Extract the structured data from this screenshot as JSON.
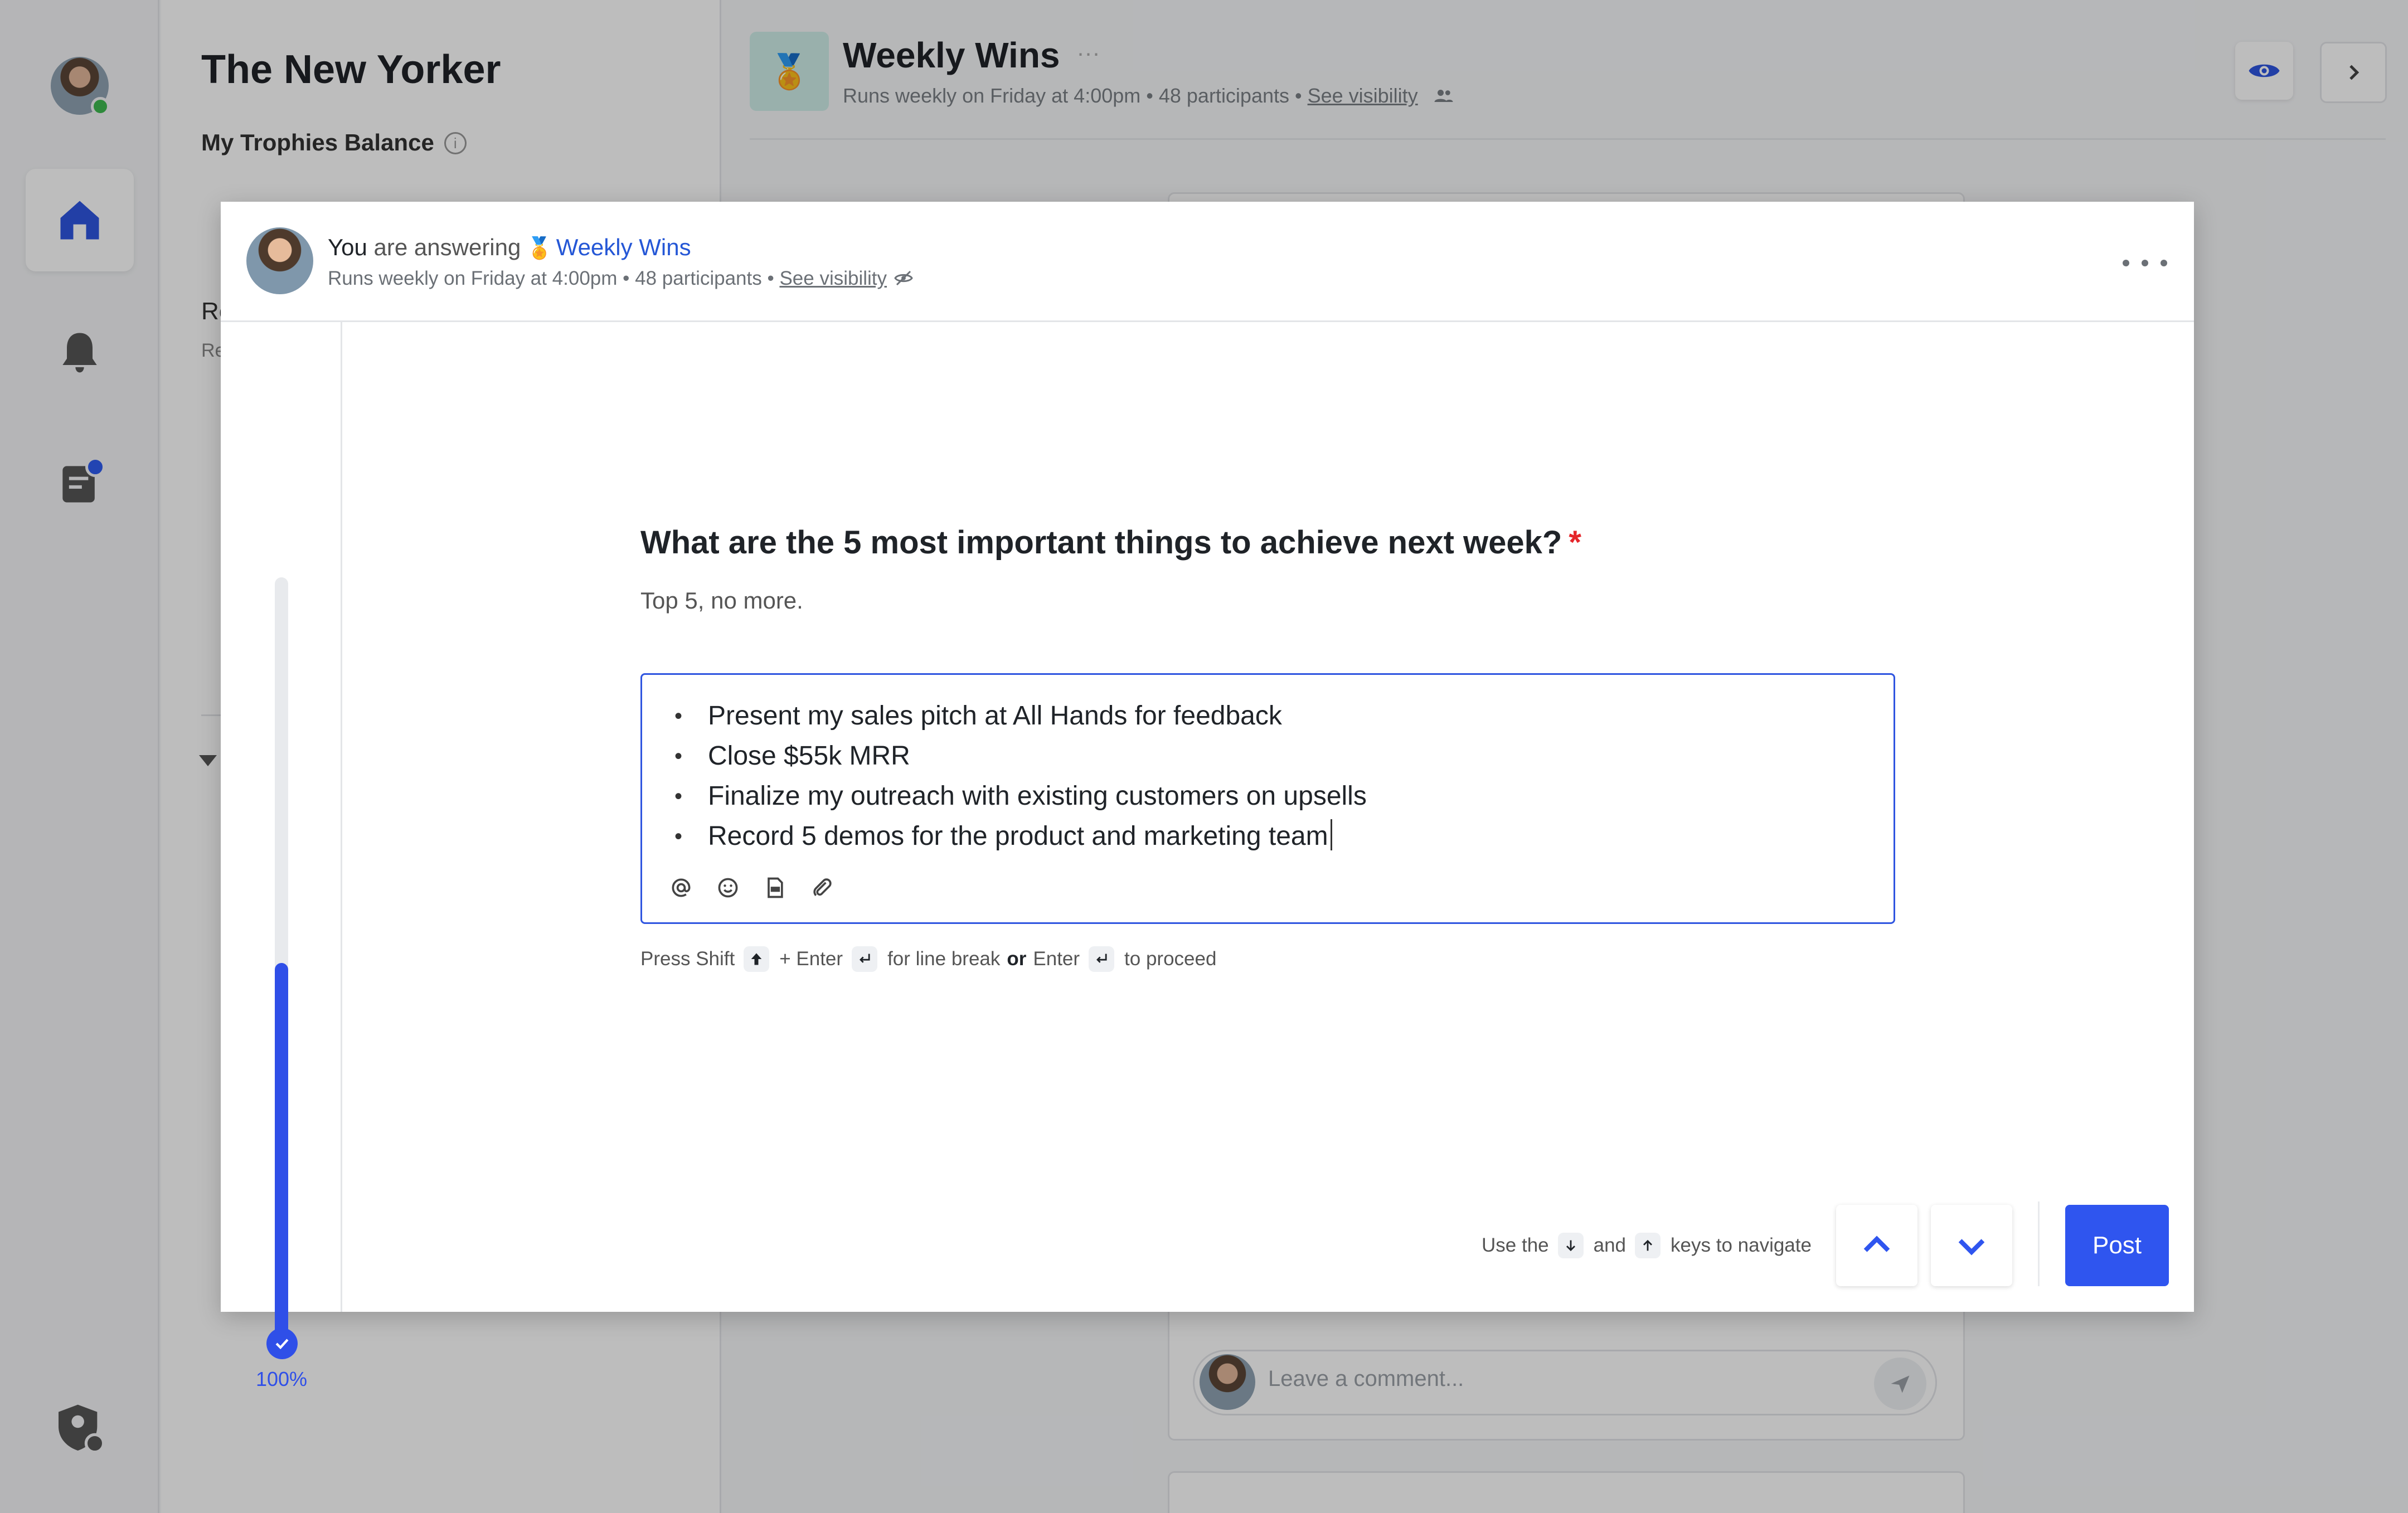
{
  "background": {
    "org_name": "The New Yorker",
    "balance_label": "My Trophies Balance",
    "balance_info": "i",
    "sidebar_fragment_a": "Re",
    "sidebar_fragment_b": "Re",
    "survey_title": "Weekly Wins",
    "survey_title_more": "···",
    "survey_meta": "Runs weekly on Friday at 4:00pm • 48 participants • ",
    "survey_visibility": "See visibility",
    "comment_placeholder": "Leave a comment..."
  },
  "modal": {
    "answering_you": "You",
    "answering_text": "are answering",
    "answering_medal": "🏅",
    "survey_name": "Weekly Wins",
    "meta": "Runs weekly on Friday at 4:00pm • 48 participants • ",
    "visibility_link": "See visibility",
    "progress_fraction": 0.5,
    "progress_label": "100%",
    "question": "What are the 5 most important things to achieve next week?",
    "required_marker": "*",
    "description": "Top 5, no more.",
    "answer_items": [
      "Present my sales pitch at All Hands for feedback",
      "Close $55k MRR",
      "Finalize my outreach with existing customers on upsells",
      "Record 5 demos for the product and marketing team"
    ],
    "toolbar_icons": [
      "mention-icon",
      "emoji-icon",
      "gif-icon",
      "attachment-icon"
    ],
    "hint": {
      "press_shift": "Press Shift",
      "plus_enter": "+ Enter",
      "for_line_break": "for line break",
      "or": "or",
      "enter": "Enter",
      "to_proceed": "to proceed"
    },
    "nav_hint": {
      "use_the": "Use the",
      "and": "and",
      "keys_to_navigate": "keys to navigate"
    },
    "post_label": "Post"
  },
  "colors": {
    "accent": "#2f55ef",
    "link": "#2557d6",
    "required": "#e5252a"
  }
}
